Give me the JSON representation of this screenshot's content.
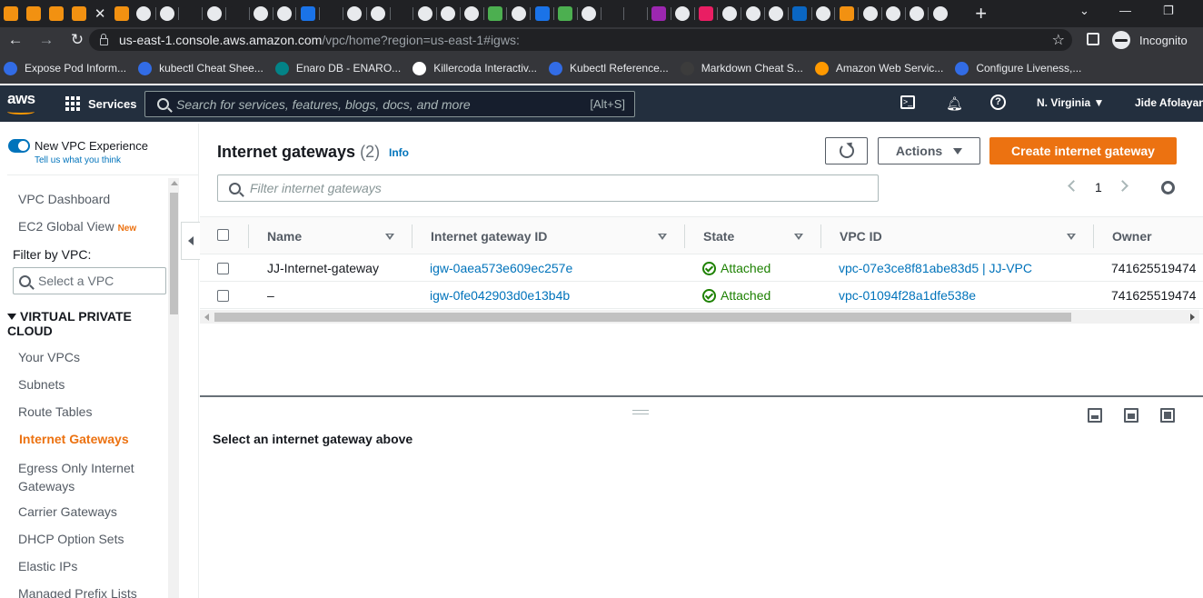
{
  "browser": {
    "tab_close": "✕",
    "new_tab": "+",
    "url_host": "us-east-1.console.aws.amazon.com",
    "url_path": "/vpc/home?region=us-east-1#igws:",
    "profile_label": "Incognito",
    "bookmarks": [
      {
        "label": "Expose Pod Inform...",
        "color": "#326ce5"
      },
      {
        "label": "kubectl Cheat Shee...",
        "color": "#326ce5"
      },
      {
        "label": "Enaro DB - ENARO...",
        "color": "#038387"
      },
      {
        "label": "Killercoda Interactiv...",
        "color": "#ffffff"
      },
      {
        "label": "Kubectl Reference...",
        "color": "#326ce5"
      },
      {
        "label": "Markdown Cheat S...",
        "color": "#3c3c3c"
      },
      {
        "label": "Amazon Web Servic...",
        "color": "#ff9900"
      },
      {
        "label": "Configure Liveness,...",
        "color": "#326ce5"
      }
    ],
    "tab_icon_colors": [
      "#f29111",
      "#f29111",
      "#f29111",
      "#f29111",
      "#f29111",
      "#e8eaed",
      "#e8eaed",
      "#202124",
      "#e8eaed",
      "#202124",
      "#e8eaed",
      "#e8eaed",
      "#1a73e8",
      "#202124",
      "#e8eaed",
      "#e8eaed",
      "#202124",
      "#e8eaed",
      "#e8eaed",
      "#e8eaed",
      "#4caf50",
      "#e8eaed",
      "#1a73e8",
      "#4caf50",
      "#e8eaed",
      "#202124",
      "#202124",
      "#9c27b0",
      "#e8eaed",
      "#e91e63",
      "#e8eaed",
      "#e8eaed",
      "#e8eaed",
      "#0a66c2",
      "#e8eaed",
      "#f29111",
      "#e8eaed",
      "#e8eaed",
      "#e8eaed",
      "#e8eaed"
    ]
  },
  "aws_nav": {
    "logo": "aws",
    "services_label": "Services",
    "search_placeholder": "Search for services, features, blogs, docs, and more",
    "search_shortcut": "[Alt+S]",
    "region": "N. Virginia ▼",
    "user": "Jide Afolayan"
  },
  "sidebar": {
    "new_vpc_experience": "New VPC Experience",
    "tell_us": "Tell us what you think",
    "vpc_dashboard": "VPC Dashboard",
    "ec2_global_view": "EC2 Global View",
    "new_badge": "New",
    "filter_label": "Filter by VPC:",
    "vpc_select_placeholder": "Select a VPC",
    "section_title": "VIRTUAL PRIVATE CLOUD",
    "items": [
      {
        "label": "Your VPCs"
      },
      {
        "label": "Subnets"
      },
      {
        "label": "Route Tables"
      },
      {
        "label": "Internet Gateways"
      },
      {
        "label": "Egress Only Internet Gateways"
      },
      {
        "label": "Carrier Gateways"
      },
      {
        "label": "DHCP Option Sets"
      },
      {
        "label": "Elastic IPs"
      },
      {
        "label": "Managed Prefix Lists"
      }
    ],
    "active_item": "Internet Gateways"
  },
  "main": {
    "title": "Internet gateways",
    "count": "(2)",
    "info": "Info",
    "actions_label": "Actions",
    "create_label": "Create internet gateway",
    "filter_placeholder": "Filter internet gateways",
    "page_number": "1",
    "columns": [
      "Name",
      "Internet gateway ID",
      "State",
      "VPC ID",
      "Owner"
    ],
    "rows": [
      {
        "name": "JJ-Internet-gateway",
        "id": "igw-0aea573e609ec257e",
        "state": "Attached",
        "vpc": "vpc-07e3ce8f81abe83d5 | JJ-VPC",
        "owner": "741625519474"
      },
      {
        "name": "–",
        "id": "igw-0fe042903d0e13b4b",
        "state": "Attached",
        "vpc": "vpc-01094f28a1dfe538e",
        "owner": "741625519474"
      }
    ],
    "split_message": "Select an internet gateway above"
  }
}
